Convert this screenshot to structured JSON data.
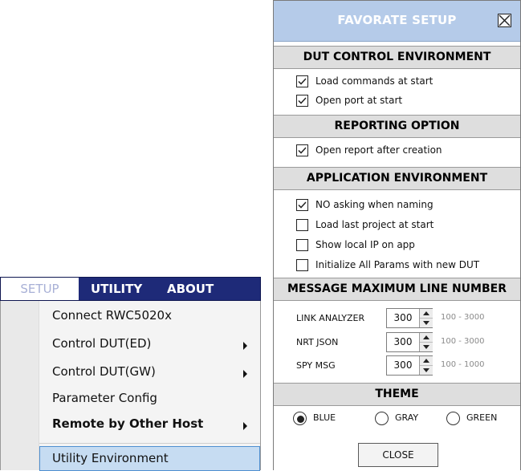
{
  "menubar": {
    "items": [
      {
        "label": "SETUP"
      },
      {
        "label": "UTILITY"
      },
      {
        "label": "ABOUT"
      }
    ]
  },
  "menu": {
    "items": [
      {
        "label": "Connect RWC5020x",
        "has_submenu": false
      },
      {
        "label": "Control DUT(ED)",
        "has_submenu": true
      },
      {
        "label": "Control DUT(GW)",
        "has_submenu": true
      },
      {
        "label": "Parameter Config",
        "has_submenu": false
      },
      {
        "label": "Remote by Other Host",
        "has_submenu": true
      },
      {
        "label": "Utility Environment",
        "has_submenu": false,
        "highlighted": true
      }
    ]
  },
  "dialog": {
    "title": "FAVORATE SETUP",
    "close_icon": "close-box-icon",
    "sections": {
      "dut": {
        "header": "DUT CONTROL ENVIRONMENT",
        "options": [
          {
            "label": "Load commands at start",
            "checked": true
          },
          {
            "label": "Open port at start",
            "checked": true
          }
        ]
      },
      "reporting": {
        "header": "REPORTING OPTION",
        "options": [
          {
            "label": "Open report after creation",
            "checked": true
          }
        ]
      },
      "application": {
        "header": "APPLICATION ENVIRONMENT",
        "options": [
          {
            "label": "NO asking when naming",
            "checked": true
          },
          {
            "label": "Load last project at start",
            "checked": false
          },
          {
            "label": "Show local IP on app",
            "checked": false
          },
          {
            "label": "Initialize All Params with new DUT",
            "checked": false
          }
        ]
      },
      "message": {
        "header": "MESSAGE MAXIMUM LINE NUMBER",
        "rows": [
          {
            "label": "LINK ANALYZER",
            "value": "300",
            "range": "100 - 3000"
          },
          {
            "label": "NRT JSON",
            "value": "300",
            "range": "100 - 3000"
          },
          {
            "label": "SPY MSG",
            "value": "300",
            "range": "100 - 1000"
          }
        ]
      },
      "theme": {
        "header": "THEME",
        "options": [
          {
            "label": "BLUE",
            "selected": true
          },
          {
            "label": "GRAY",
            "selected": false
          },
          {
            "label": "GREEN",
            "selected": false
          }
        ]
      }
    },
    "close_button": "CLOSE"
  }
}
